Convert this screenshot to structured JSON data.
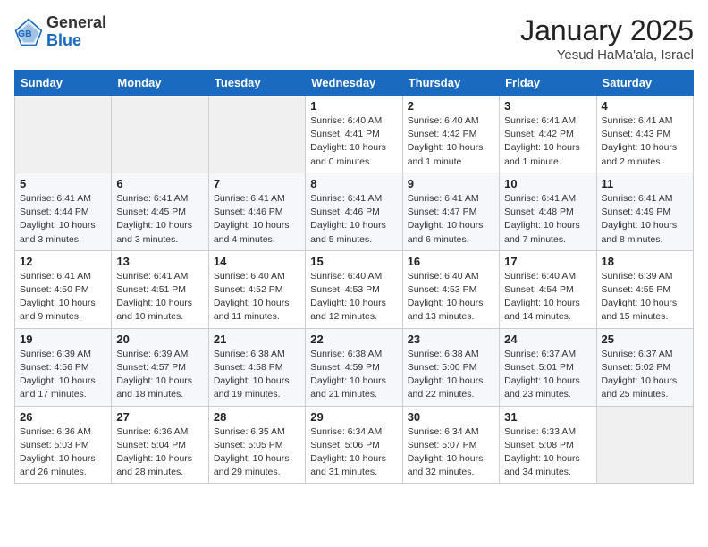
{
  "header": {
    "logo_general": "General",
    "logo_blue": "Blue",
    "month_title": "January 2025",
    "subtitle": "Yesud HaMa'ala, Israel"
  },
  "weekdays": [
    "Sunday",
    "Monday",
    "Tuesday",
    "Wednesday",
    "Thursday",
    "Friday",
    "Saturday"
  ],
  "weeks": [
    [
      {
        "day": "",
        "info": ""
      },
      {
        "day": "",
        "info": ""
      },
      {
        "day": "",
        "info": ""
      },
      {
        "day": "1",
        "info": "Sunrise: 6:40 AM\nSunset: 4:41 PM\nDaylight: 10 hours\nand 0 minutes."
      },
      {
        "day": "2",
        "info": "Sunrise: 6:40 AM\nSunset: 4:42 PM\nDaylight: 10 hours\nand 1 minute."
      },
      {
        "day": "3",
        "info": "Sunrise: 6:41 AM\nSunset: 4:42 PM\nDaylight: 10 hours\nand 1 minute."
      },
      {
        "day": "4",
        "info": "Sunrise: 6:41 AM\nSunset: 4:43 PM\nDaylight: 10 hours\nand 2 minutes."
      }
    ],
    [
      {
        "day": "5",
        "info": "Sunrise: 6:41 AM\nSunset: 4:44 PM\nDaylight: 10 hours\nand 3 minutes."
      },
      {
        "day": "6",
        "info": "Sunrise: 6:41 AM\nSunset: 4:45 PM\nDaylight: 10 hours\nand 3 minutes."
      },
      {
        "day": "7",
        "info": "Sunrise: 6:41 AM\nSunset: 4:46 PM\nDaylight: 10 hours\nand 4 minutes."
      },
      {
        "day": "8",
        "info": "Sunrise: 6:41 AM\nSunset: 4:46 PM\nDaylight: 10 hours\nand 5 minutes."
      },
      {
        "day": "9",
        "info": "Sunrise: 6:41 AM\nSunset: 4:47 PM\nDaylight: 10 hours\nand 6 minutes."
      },
      {
        "day": "10",
        "info": "Sunrise: 6:41 AM\nSunset: 4:48 PM\nDaylight: 10 hours\nand 7 minutes."
      },
      {
        "day": "11",
        "info": "Sunrise: 6:41 AM\nSunset: 4:49 PM\nDaylight: 10 hours\nand 8 minutes."
      }
    ],
    [
      {
        "day": "12",
        "info": "Sunrise: 6:41 AM\nSunset: 4:50 PM\nDaylight: 10 hours\nand 9 minutes."
      },
      {
        "day": "13",
        "info": "Sunrise: 6:41 AM\nSunset: 4:51 PM\nDaylight: 10 hours\nand 10 minutes."
      },
      {
        "day": "14",
        "info": "Sunrise: 6:40 AM\nSunset: 4:52 PM\nDaylight: 10 hours\nand 11 minutes."
      },
      {
        "day": "15",
        "info": "Sunrise: 6:40 AM\nSunset: 4:53 PM\nDaylight: 10 hours\nand 12 minutes."
      },
      {
        "day": "16",
        "info": "Sunrise: 6:40 AM\nSunset: 4:53 PM\nDaylight: 10 hours\nand 13 minutes."
      },
      {
        "day": "17",
        "info": "Sunrise: 6:40 AM\nSunset: 4:54 PM\nDaylight: 10 hours\nand 14 minutes."
      },
      {
        "day": "18",
        "info": "Sunrise: 6:39 AM\nSunset: 4:55 PM\nDaylight: 10 hours\nand 15 minutes."
      }
    ],
    [
      {
        "day": "19",
        "info": "Sunrise: 6:39 AM\nSunset: 4:56 PM\nDaylight: 10 hours\nand 17 minutes."
      },
      {
        "day": "20",
        "info": "Sunrise: 6:39 AM\nSunset: 4:57 PM\nDaylight: 10 hours\nand 18 minutes."
      },
      {
        "day": "21",
        "info": "Sunrise: 6:38 AM\nSunset: 4:58 PM\nDaylight: 10 hours\nand 19 minutes."
      },
      {
        "day": "22",
        "info": "Sunrise: 6:38 AM\nSunset: 4:59 PM\nDaylight: 10 hours\nand 21 minutes."
      },
      {
        "day": "23",
        "info": "Sunrise: 6:38 AM\nSunset: 5:00 PM\nDaylight: 10 hours\nand 22 minutes."
      },
      {
        "day": "24",
        "info": "Sunrise: 6:37 AM\nSunset: 5:01 PM\nDaylight: 10 hours\nand 23 minutes."
      },
      {
        "day": "25",
        "info": "Sunrise: 6:37 AM\nSunset: 5:02 PM\nDaylight: 10 hours\nand 25 minutes."
      }
    ],
    [
      {
        "day": "26",
        "info": "Sunrise: 6:36 AM\nSunset: 5:03 PM\nDaylight: 10 hours\nand 26 minutes."
      },
      {
        "day": "27",
        "info": "Sunrise: 6:36 AM\nSunset: 5:04 PM\nDaylight: 10 hours\nand 28 minutes."
      },
      {
        "day": "28",
        "info": "Sunrise: 6:35 AM\nSunset: 5:05 PM\nDaylight: 10 hours\nand 29 minutes."
      },
      {
        "day": "29",
        "info": "Sunrise: 6:34 AM\nSunset: 5:06 PM\nDaylight: 10 hours\nand 31 minutes."
      },
      {
        "day": "30",
        "info": "Sunrise: 6:34 AM\nSunset: 5:07 PM\nDaylight: 10 hours\nand 32 minutes."
      },
      {
        "day": "31",
        "info": "Sunrise: 6:33 AM\nSunset: 5:08 PM\nDaylight: 10 hours\nand 34 minutes."
      },
      {
        "day": "",
        "info": ""
      }
    ]
  ]
}
